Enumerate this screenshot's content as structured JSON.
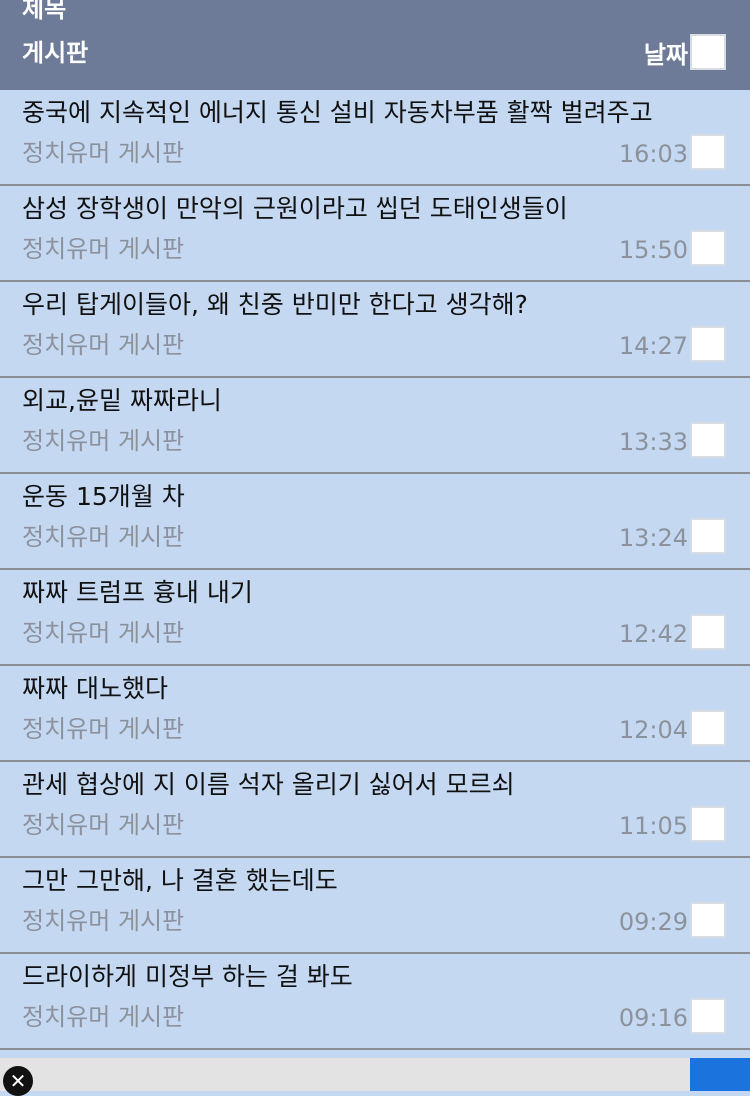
{
  "header": {
    "title": "제목",
    "board_label": "게시판",
    "date_label": "날짜"
  },
  "posts": [
    {
      "title": "중국에 지속적인 에너지 통신 설비 자동차부품 활짝 벌려주고",
      "board": "정치유머 게시판",
      "time": "16:03"
    },
    {
      "title": "삼성 장학생이 만악의 근원이라고 씹던 도태인생들이",
      "board": "정치유머 게시판",
      "time": "15:50"
    },
    {
      "title": "우리 탑게이들아, 왜 친중 반미만 한다고 생각해?",
      "board": "정치유머 게시판",
      "time": "14:27"
    },
    {
      "title": "외교,윤밑 짜짜라니",
      "board": "정치유머 게시판",
      "time": "13:33"
    },
    {
      "title": "운동 15개월 차",
      "board": "정치유머 게시판",
      "time": "13:24"
    },
    {
      "title": "짜짜 트럼프 흉내 내기",
      "board": "정치유머 게시판",
      "time": "12:42"
    },
    {
      "title": "짜짜 대노했다",
      "board": "정치유머 게시판",
      "time": "12:04"
    },
    {
      "title": "관세 협상에 지 이름 석자 올리기 싫어서 모르쇠",
      "board": "정치유머 게시판",
      "time": "11:05"
    },
    {
      "title": "그만 그만해, 나 결혼 했는데도",
      "board": "정치유머 게시판",
      "time": "09:29"
    },
    {
      "title": "드라이하게 미정부 하는 걸 봐도",
      "board": "정치유머 게시판",
      "time": "09:16"
    }
  ],
  "footer": {
    "close_icon": "close-icon",
    "close_glyph": "✕"
  }
}
